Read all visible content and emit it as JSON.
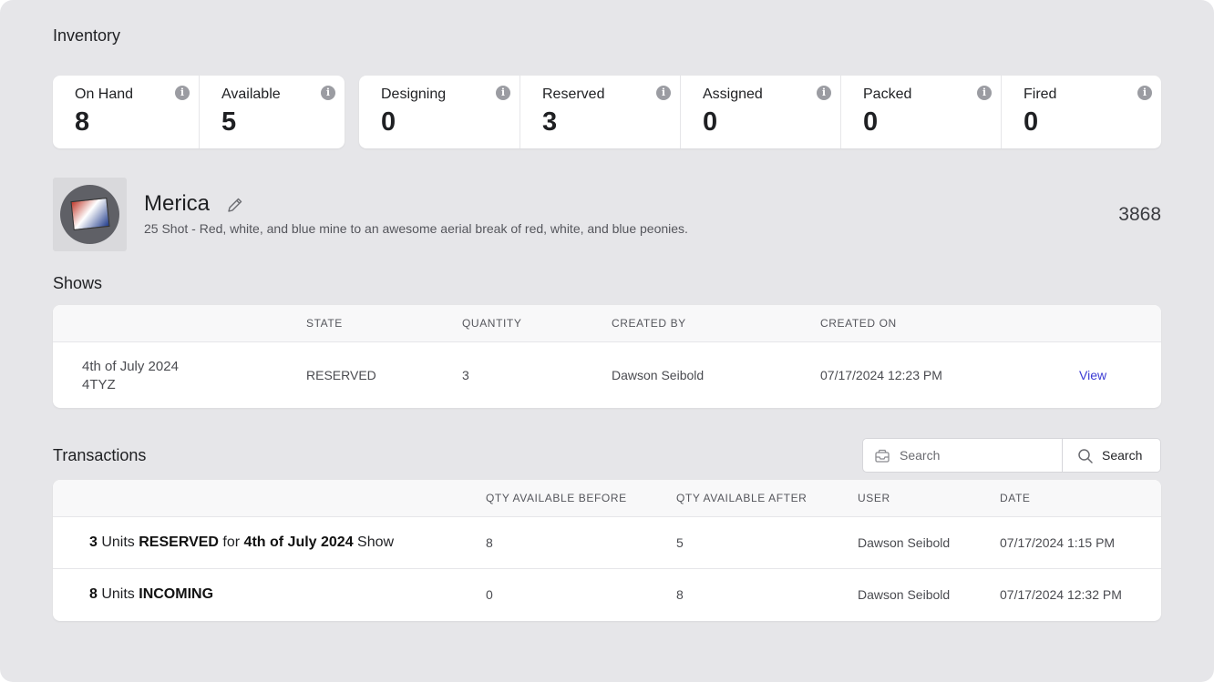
{
  "inventory": {
    "title": "Inventory",
    "stock_group": [
      {
        "label": "On Hand",
        "value": "8"
      },
      {
        "label": "Available",
        "value": "5"
      }
    ],
    "status_group": [
      {
        "label": "Designing",
        "value": "0"
      },
      {
        "label": "Reserved",
        "value": "3"
      },
      {
        "label": "Assigned",
        "value": "0"
      },
      {
        "label": "Packed",
        "value": "0"
      },
      {
        "label": "Fired",
        "value": "0"
      }
    ],
    "info_icon": "info-icon"
  },
  "product": {
    "name": "Merica",
    "description": "25 Shot - Red, white, and blue mine to an awesome aerial break of red, white, and blue peonies.",
    "id": "3868"
  },
  "shows": {
    "title": "Shows",
    "columns": [
      "",
      "STATE",
      "QUANTITY",
      "CREATED BY",
      "CREATED ON",
      ""
    ],
    "rows": [
      {
        "name": "4th of July 2024",
        "code": "4TYZ",
        "state": "RESERVED",
        "quantity": "3",
        "created_by": "Dawson Seibold",
        "created_on": "07/17/2024 12:23 PM",
        "action": "View"
      }
    ]
  },
  "transactions": {
    "title": "Transactions",
    "search": {
      "placeholder": "Search",
      "button_label": "Search"
    },
    "columns": [
      "",
      "QTY AVAILABLE BEFORE",
      "QTY AVAILABLE AFTER",
      "USER",
      "DATE"
    ],
    "rows": [
      {
        "qty": "3",
        "units_word": " Units ",
        "action": "RESERVED",
        "for_word": " for ",
        "show": "4th of July 2024",
        "suffix": " Show",
        "before": "8",
        "after": "5",
        "user": "Dawson Seibold",
        "date": "07/17/2024 1:15 PM"
      },
      {
        "qty": "8",
        "units_word": " Units ",
        "action": "INCOMING",
        "before": "0",
        "after": "8",
        "user": "Dawson Seibold",
        "date": "07/17/2024 12:32 PM"
      }
    ]
  },
  "colors": {
    "background": "#e6e6e9",
    "card": "#ffffff",
    "link": "#3b3bd4",
    "info_icon": "#9b9ca2"
  }
}
